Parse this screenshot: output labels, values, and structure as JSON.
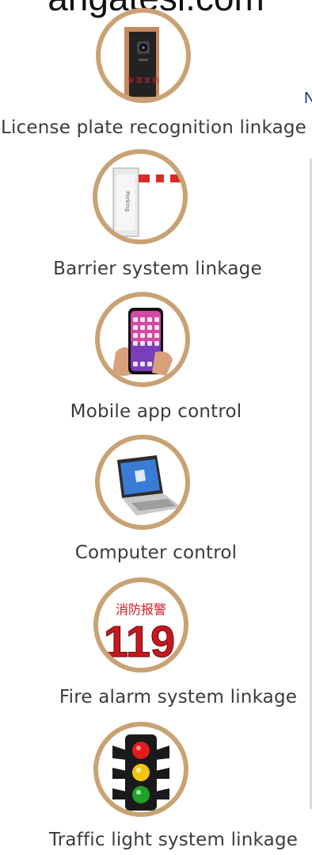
{
  "header": {
    "site_text": "angatesl.com"
  },
  "edge_text": "N",
  "features": [
    {
      "label": "License plate recognition linkage",
      "icon": "license-plate-camera-icon",
      "badge": "智 慧 安 防"
    },
    {
      "label": "Barrier system linkage",
      "icon": "barrier-gate-icon"
    },
    {
      "label": "Mobile app control",
      "icon": "smartphone-icon"
    },
    {
      "label": "Computer control",
      "icon": "laptop-icon"
    },
    {
      "label": "Fire alarm system linkage",
      "icon": "fire-alarm-119-icon",
      "badge_text": "消防报警",
      "badge_number": "119"
    },
    {
      "label": "Traffic light system linkage",
      "icon": "traffic-light-icon"
    }
  ],
  "colors": {
    "ring": "#c9a274",
    "text": "#3b3b3b",
    "accent_blue": "#1c2f7a",
    "fire_red": "#d71920"
  }
}
